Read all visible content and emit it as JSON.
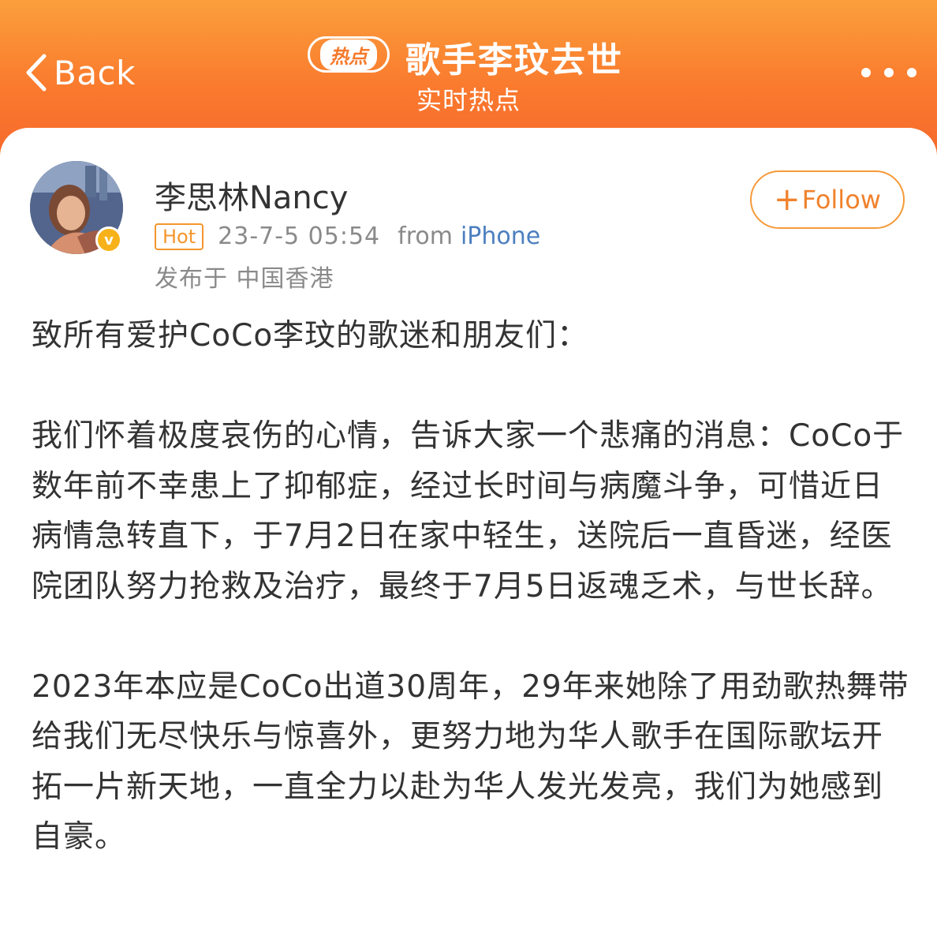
{
  "header": {
    "back_label": "Back",
    "hot_pill": "热点",
    "topic_title": "歌手李玟去世",
    "topic_subtitle": "实时热点"
  },
  "post": {
    "username": "李思林Nancy",
    "badge": "Hot",
    "time": "23-7-5 05:54",
    "from_label": "from",
    "device": "iPhone",
    "location": "发布于 中国香港",
    "follow_label": "Follow",
    "paragraphs": [
      "致所有爱护CoCo李玟的歌迷和朋友们：",
      "我们怀着极度哀伤的心情，告诉大家一个悲痛的消息：CoCo于数年前不幸患上了抑郁症，经过长时间与病魔斗争，可惜近日病情急转直下，于7月2日在家中轻生，送院后一直昏迷，经医院团队努力抢救及治疗，最终于7月5日返魂乏术，与世长辞。",
      "2023年本应是CoCo出道30周年，29年来她除了用劲歌热舞带给我们无尽快乐与惊喜外，更努力地为华人歌手在国际歌坛开拓一片新天地，一直全力以赴为华人发光发亮，我们为她感到自豪。"
    ]
  },
  "colors": {
    "header_top": "#fb9f3b",
    "header_bottom": "#f6692c",
    "accent": "#f5952d",
    "device_link": "#4c7fbf",
    "verified": "#f7b21a"
  },
  "icons": {
    "back": "chevron-left-icon",
    "more": "more-dots-icon",
    "verified": "verified-badge-icon"
  }
}
